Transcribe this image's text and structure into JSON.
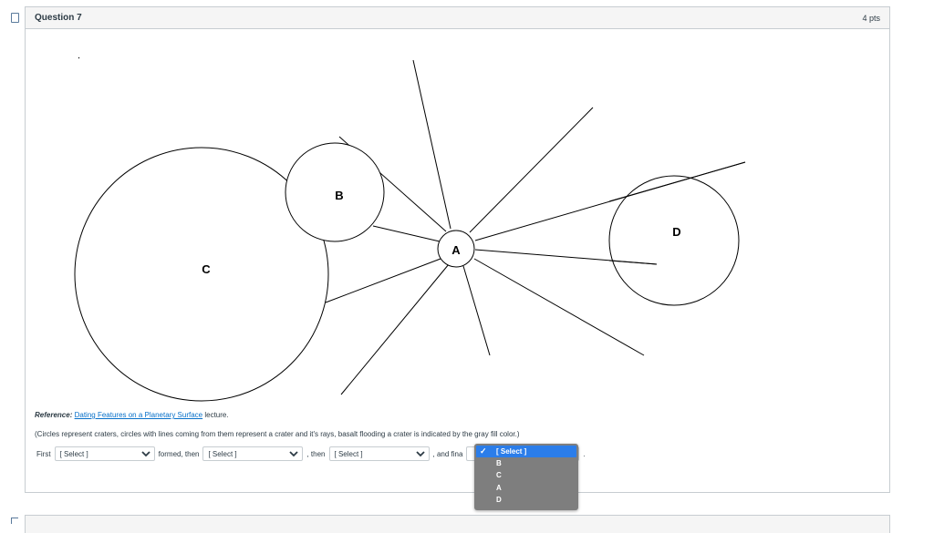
{
  "question": {
    "title": "Question 7",
    "points": "4 pts"
  },
  "diagram": {
    "craters": [
      {
        "label": "A",
        "has_rays": true
      },
      {
        "label": "B",
        "has_rays": false
      },
      {
        "label": "C",
        "has_rays": false
      },
      {
        "label": "D",
        "has_rays": false
      }
    ]
  },
  "reference": {
    "label": "Reference:",
    "link_text": "Dating Features on a Planetary Surface",
    "suffix": "lecture."
  },
  "note": "(Circles represent craters, circles with lines coming from them represent a crater and it's rays, basalt flooding a crater is indicated by the gray fill color.)",
  "answer": {
    "first_label": "First",
    "formed_then": "formed, then",
    "then": ", then",
    "and_finally": ", and fina",
    "end": ".",
    "selects": [
      {
        "value": "[ Select ]"
      },
      {
        "value": "[ Select ]"
      },
      {
        "value": "[ Select ]"
      },
      {
        "value": ""
      }
    ]
  },
  "dropdown": {
    "options": [
      "[ Select ]",
      "B",
      "C",
      "A",
      "D"
    ],
    "selected_index": 0
  },
  "colors": {
    "border": "#c7cdd1",
    "link": "#0770c9",
    "dropdown_bg": "#7e7e7e",
    "dropdown_selected": "#2b7de9"
  }
}
